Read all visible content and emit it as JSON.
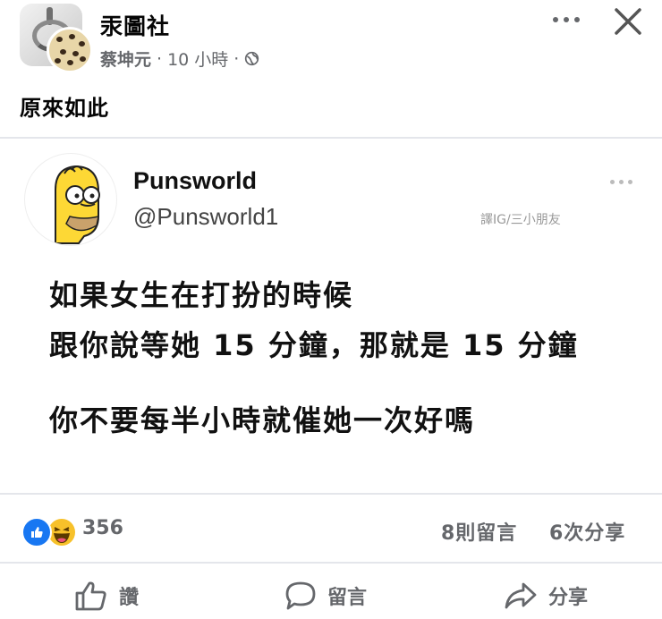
{
  "post": {
    "group_name": "汞圖社",
    "author": "蔡坤元",
    "time": "10 小時",
    "sep": "·",
    "text": "原來如此"
  },
  "embed": {
    "account_name": "Punsworld",
    "handle": "@Punsworld1",
    "credit": "譯IG/三小朋友",
    "line1": "如果女生在打扮的時候",
    "line2": "跟你說等她 15 分鐘，那就是 15 分鐘",
    "line3": "你不要每半小時就催她一次好嗎"
  },
  "stats": {
    "reaction_count": "356",
    "comments": "8則留言",
    "shares": "6次分享"
  },
  "actions": {
    "like": "讚",
    "comment": "留言",
    "share": "分享"
  },
  "colors": {
    "like_blue": "#1877f2",
    "haha_yellow": "#f7c12a",
    "secondary_text": "#65676b",
    "divider": "#e4e6eb"
  },
  "icons": [
    "more-dots-icon",
    "close-icon",
    "globe-icon",
    "like-reaction-icon",
    "haha-reaction-icon",
    "thumbs-up-icon",
    "comment-bubble-icon",
    "share-arrow-icon"
  ]
}
